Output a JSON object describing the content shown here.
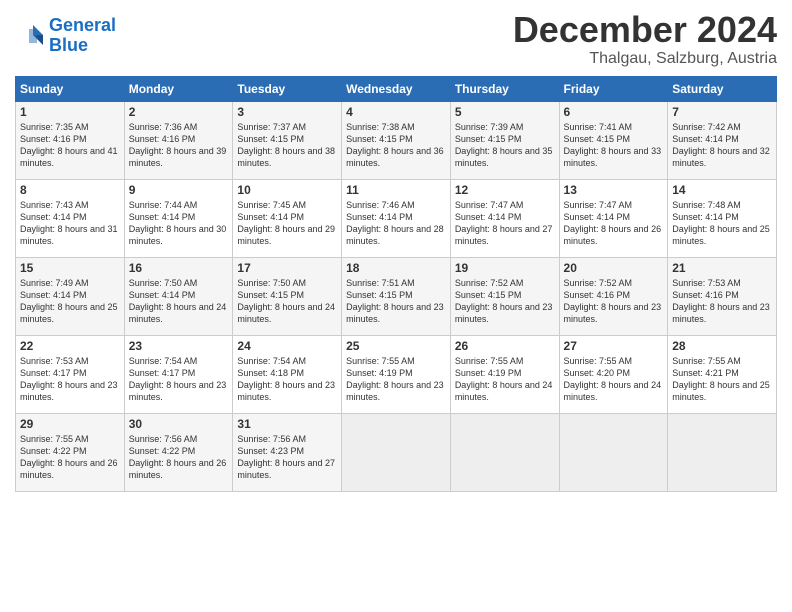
{
  "header": {
    "logo_line1": "General",
    "logo_line2": "Blue",
    "month": "December 2024",
    "location": "Thalgau, Salzburg, Austria"
  },
  "days_of_week": [
    "Sunday",
    "Monday",
    "Tuesday",
    "Wednesday",
    "Thursday",
    "Friday",
    "Saturday"
  ],
  "weeks": [
    [
      {
        "num": "1",
        "sunrise": "7:35 AM",
        "sunset": "4:16 PM",
        "daylight": "8 hours and 41 minutes."
      },
      {
        "num": "2",
        "sunrise": "7:36 AM",
        "sunset": "4:16 PM",
        "daylight": "8 hours and 39 minutes."
      },
      {
        "num": "3",
        "sunrise": "7:37 AM",
        "sunset": "4:15 PM",
        "daylight": "8 hours and 38 minutes."
      },
      {
        "num": "4",
        "sunrise": "7:38 AM",
        "sunset": "4:15 PM",
        "daylight": "8 hours and 36 minutes."
      },
      {
        "num": "5",
        "sunrise": "7:39 AM",
        "sunset": "4:15 PM",
        "daylight": "8 hours and 35 minutes."
      },
      {
        "num": "6",
        "sunrise": "7:41 AM",
        "sunset": "4:15 PM",
        "daylight": "8 hours and 33 minutes."
      },
      {
        "num": "7",
        "sunrise": "7:42 AM",
        "sunset": "4:14 PM",
        "daylight": "8 hours and 32 minutes."
      }
    ],
    [
      {
        "num": "8",
        "sunrise": "7:43 AM",
        "sunset": "4:14 PM",
        "daylight": "8 hours and 31 minutes."
      },
      {
        "num": "9",
        "sunrise": "7:44 AM",
        "sunset": "4:14 PM",
        "daylight": "8 hours and 30 minutes."
      },
      {
        "num": "10",
        "sunrise": "7:45 AM",
        "sunset": "4:14 PM",
        "daylight": "8 hours and 29 minutes."
      },
      {
        "num": "11",
        "sunrise": "7:46 AM",
        "sunset": "4:14 PM",
        "daylight": "8 hours and 28 minutes."
      },
      {
        "num": "12",
        "sunrise": "7:47 AM",
        "sunset": "4:14 PM",
        "daylight": "8 hours and 27 minutes."
      },
      {
        "num": "13",
        "sunrise": "7:47 AM",
        "sunset": "4:14 PM",
        "daylight": "8 hours and 26 minutes."
      },
      {
        "num": "14",
        "sunrise": "7:48 AM",
        "sunset": "4:14 PM",
        "daylight": "8 hours and 25 minutes."
      }
    ],
    [
      {
        "num": "15",
        "sunrise": "7:49 AM",
        "sunset": "4:14 PM",
        "daylight": "8 hours and 25 minutes."
      },
      {
        "num": "16",
        "sunrise": "7:50 AM",
        "sunset": "4:14 PM",
        "daylight": "8 hours and 24 minutes."
      },
      {
        "num": "17",
        "sunrise": "7:50 AM",
        "sunset": "4:15 PM",
        "daylight": "8 hours and 24 minutes."
      },
      {
        "num": "18",
        "sunrise": "7:51 AM",
        "sunset": "4:15 PM",
        "daylight": "8 hours and 23 minutes."
      },
      {
        "num": "19",
        "sunrise": "7:52 AM",
        "sunset": "4:15 PM",
        "daylight": "8 hours and 23 minutes."
      },
      {
        "num": "20",
        "sunrise": "7:52 AM",
        "sunset": "4:16 PM",
        "daylight": "8 hours and 23 minutes."
      },
      {
        "num": "21",
        "sunrise": "7:53 AM",
        "sunset": "4:16 PM",
        "daylight": "8 hours and 23 minutes."
      }
    ],
    [
      {
        "num": "22",
        "sunrise": "7:53 AM",
        "sunset": "4:17 PM",
        "daylight": "8 hours and 23 minutes."
      },
      {
        "num": "23",
        "sunrise": "7:54 AM",
        "sunset": "4:17 PM",
        "daylight": "8 hours and 23 minutes."
      },
      {
        "num": "24",
        "sunrise": "7:54 AM",
        "sunset": "4:18 PM",
        "daylight": "8 hours and 23 minutes."
      },
      {
        "num": "25",
        "sunrise": "7:55 AM",
        "sunset": "4:19 PM",
        "daylight": "8 hours and 23 minutes."
      },
      {
        "num": "26",
        "sunrise": "7:55 AM",
        "sunset": "4:19 PM",
        "daylight": "8 hours and 24 minutes."
      },
      {
        "num": "27",
        "sunrise": "7:55 AM",
        "sunset": "4:20 PM",
        "daylight": "8 hours and 24 minutes."
      },
      {
        "num": "28",
        "sunrise": "7:55 AM",
        "sunset": "4:21 PM",
        "daylight": "8 hours and 25 minutes."
      }
    ],
    [
      {
        "num": "29",
        "sunrise": "7:55 AM",
        "sunset": "4:22 PM",
        "daylight": "8 hours and 26 minutes."
      },
      {
        "num": "30",
        "sunrise": "7:56 AM",
        "sunset": "4:22 PM",
        "daylight": "8 hours and 26 minutes."
      },
      {
        "num": "31",
        "sunrise": "7:56 AM",
        "sunset": "4:23 PM",
        "daylight": "8 hours and 27 minutes."
      },
      null,
      null,
      null,
      null
    ]
  ]
}
